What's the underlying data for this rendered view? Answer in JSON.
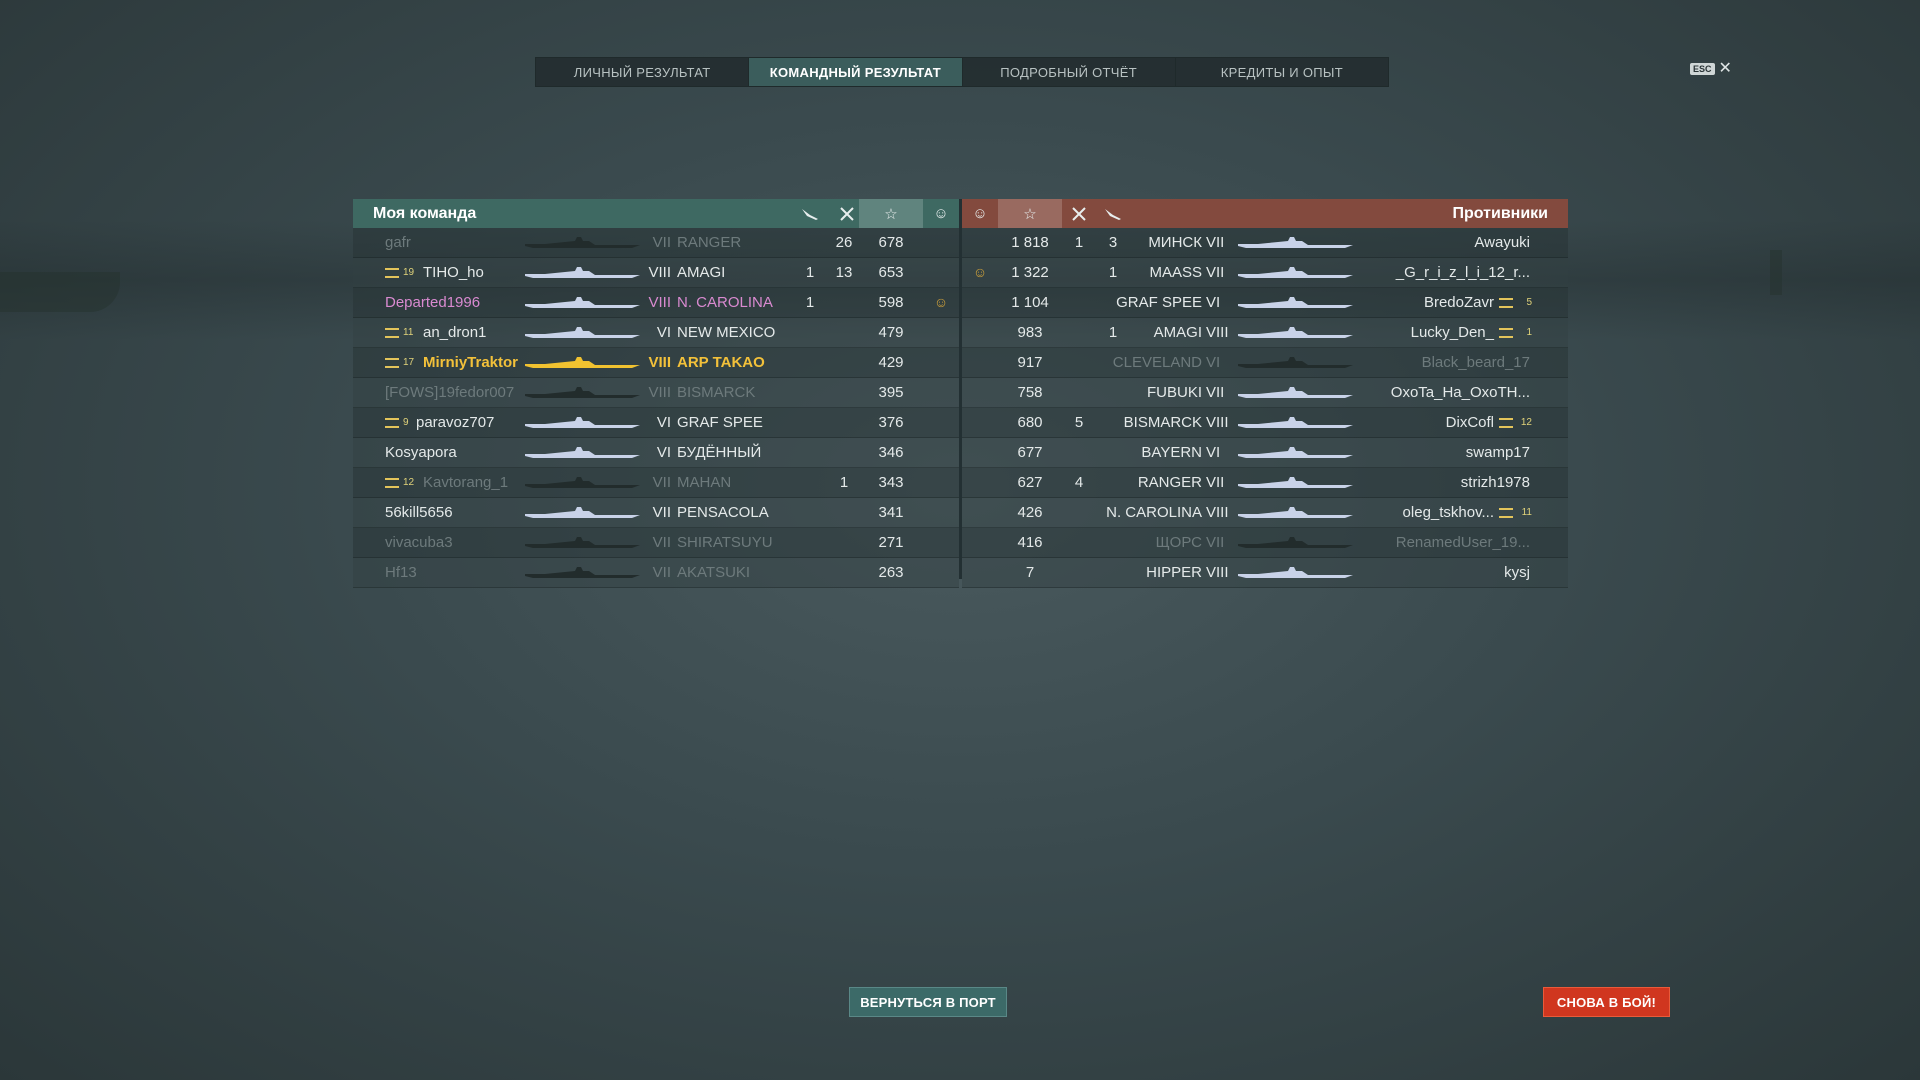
{
  "tabs": [
    {
      "label": "ЛИЧНЫЙ РЕЗУЛЬТАТ",
      "active": false
    },
    {
      "label": "КОМАНДНЫЙ РЕЗУЛЬТАТ",
      "active": true
    },
    {
      "label": "ПОДРОБНЫЙ ОТЧЁТ",
      "active": false
    },
    {
      "label": "КРЕДИТЫ И ОПЫТ",
      "active": false
    }
  ],
  "close": {
    "key": "ESC",
    "symbol": "✕"
  },
  "left_team": {
    "title": "Моя команда",
    "header_icons": [
      "plane-icon",
      "crossed-swords-icon",
      "star-icon",
      "medal-icon"
    ],
    "rows": [
      {
        "rank": "",
        "player": "gafr",
        "tier": "VII",
        "ship": "RANGER",
        "planes": "",
        "kills": "26",
        "xp": "678",
        "medal": "",
        "state": "dead"
      },
      {
        "rank": "19",
        "player": "TIHO_ho",
        "tier": "VIII",
        "ship": "AMAGI",
        "planes": "1",
        "kills": "13",
        "xp": "653",
        "medal": "",
        "state": "alive"
      },
      {
        "rank": "",
        "player": "Departed1996",
        "tier": "VIII",
        "ship": "N. CAROLINA",
        "planes": "1",
        "kills": "",
        "xp": "598",
        "medal": "☺",
        "state": "division"
      },
      {
        "rank": "11",
        "player": "an_dron1",
        "tier": "VI",
        "ship": "NEW MEXICO",
        "planes": "",
        "kills": "",
        "xp": "479",
        "medal": "",
        "state": "alive"
      },
      {
        "rank": "17",
        "player": "MirniyTraktor",
        "tier": "VIII",
        "ship": "ARP TAKAO",
        "planes": "",
        "kills": "",
        "xp": "429",
        "medal": "",
        "state": "me"
      },
      {
        "rank": "",
        "player": "[FOWS]19fedor007",
        "tier": "VIII",
        "ship": "BISMARCK",
        "planes": "",
        "kills": "",
        "xp": "395",
        "medal": "",
        "state": "dead"
      },
      {
        "rank": "9",
        "player": "paravoz707",
        "tier": "VI",
        "ship": "GRAF SPEE",
        "planes": "",
        "kills": "",
        "xp": "376",
        "medal": "",
        "state": "alive"
      },
      {
        "rank": "",
        "player": "Kosyapora",
        "tier": "VI",
        "ship": "БУДЁННЫЙ",
        "planes": "",
        "kills": "",
        "xp": "346",
        "medal": "",
        "state": "alive"
      },
      {
        "rank": "12",
        "player": "Kavtorang_1",
        "tier": "VII",
        "ship": "MAHAN",
        "planes": "",
        "kills": "1",
        "xp": "343",
        "medal": "",
        "state": "dead"
      },
      {
        "rank": "",
        "player": "56kill5656",
        "tier": "VII",
        "ship": "PENSACOLA",
        "planes": "",
        "kills": "",
        "xp": "341",
        "medal": "",
        "state": "alive"
      },
      {
        "rank": "",
        "player": "vivacuba3",
        "tier": "VII",
        "ship": "SHIRATSUYU",
        "planes": "",
        "kills": "",
        "xp": "271",
        "medal": "",
        "state": "dead"
      },
      {
        "rank": "",
        "player": "Hf13",
        "tier": "VII",
        "ship": "AKATSUKI",
        "planes": "",
        "kills": "",
        "xp": "263",
        "medal": "",
        "state": "dead"
      }
    ]
  },
  "right_team": {
    "title": "Противники",
    "header_icons": [
      "medal-icon",
      "star-icon",
      "crossed-swords-icon",
      "plane-icon"
    ],
    "rows": [
      {
        "medal": "",
        "xp": "1 818",
        "kills": "1",
        "planes": "3",
        "ship": "МИНСК",
        "tier": "VII",
        "player": "Awayuki",
        "rank": "",
        "state": "alive"
      },
      {
        "medal": "☺",
        "xp": "1 322",
        "kills": "",
        "planes": "1",
        "ship": "MAASS",
        "tier": "VII",
        "player": "_G_r_i_z_l_i_12_r...",
        "rank": "",
        "state": "alive"
      },
      {
        "medal": "",
        "xp": "1 104",
        "kills": "",
        "planes": "",
        "ship": "GRAF SPEE",
        "tier": "VI",
        "player": "BredoZavr",
        "rank": "5",
        "state": "alive"
      },
      {
        "medal": "",
        "xp": "983",
        "kills": "",
        "planes": "1",
        "ship": "AMAGI",
        "tier": "VIII",
        "player": "Lucky_Den_",
        "rank": "1",
        "state": "alive"
      },
      {
        "medal": "",
        "xp": "917",
        "kills": "",
        "planes": "",
        "ship": "CLEVELAND",
        "tier": "VI",
        "player": "Black_beard_17",
        "rank": "",
        "state": "dead"
      },
      {
        "medal": "",
        "xp": "758",
        "kills": "",
        "planes": "",
        "ship": "FUBUKI",
        "tier": "VII",
        "player": "OxoTa_Ha_OxoTH...",
        "rank": "",
        "state": "alive"
      },
      {
        "medal": "",
        "xp": "680",
        "kills": "5",
        "planes": "",
        "ship": "BISMARCK",
        "tier": "VIII",
        "player": "DixCofl",
        "rank": "12",
        "state": "alive"
      },
      {
        "medal": "",
        "xp": "677",
        "kills": "",
        "planes": "",
        "ship": "BAYERN",
        "tier": "VI",
        "player": "swamp17",
        "rank": "",
        "state": "alive"
      },
      {
        "medal": "",
        "xp": "627",
        "kills": "4",
        "planes": "",
        "ship": "RANGER",
        "tier": "VII",
        "player": "strizh1978",
        "rank": "",
        "state": "alive"
      },
      {
        "medal": "",
        "xp": "426",
        "kills": "",
        "planes": "",
        "ship": "N. CAROLINA",
        "tier": "VIII",
        "player": "oleg_tskhov...",
        "rank": "11",
        "state": "alive"
      },
      {
        "medal": "",
        "xp": "416",
        "kills": "",
        "planes": "",
        "ship": "ЩОРС",
        "tier": "VII",
        "player": "RenamedUser_19...",
        "rank": "",
        "state": "dead"
      },
      {
        "medal": "",
        "xp": "7",
        "kills": "",
        "planes": "",
        "ship": "HIPPER",
        "tier": "VIII",
        "player": "kysj",
        "rank": "",
        "state": "alive"
      }
    ]
  },
  "buttons": {
    "port": "ВЕРНУТЬСЯ В ПОРТ",
    "battle": "СНОВА В БОЙ!"
  },
  "colors": {
    "my_team_header": "#3e6962",
    "enemy_team_header": "#834a3e",
    "player_highlight": "#f3c13a",
    "division": "#d98ad0",
    "battle_button": "#d0361f",
    "port_button": "#3c6a68"
  }
}
